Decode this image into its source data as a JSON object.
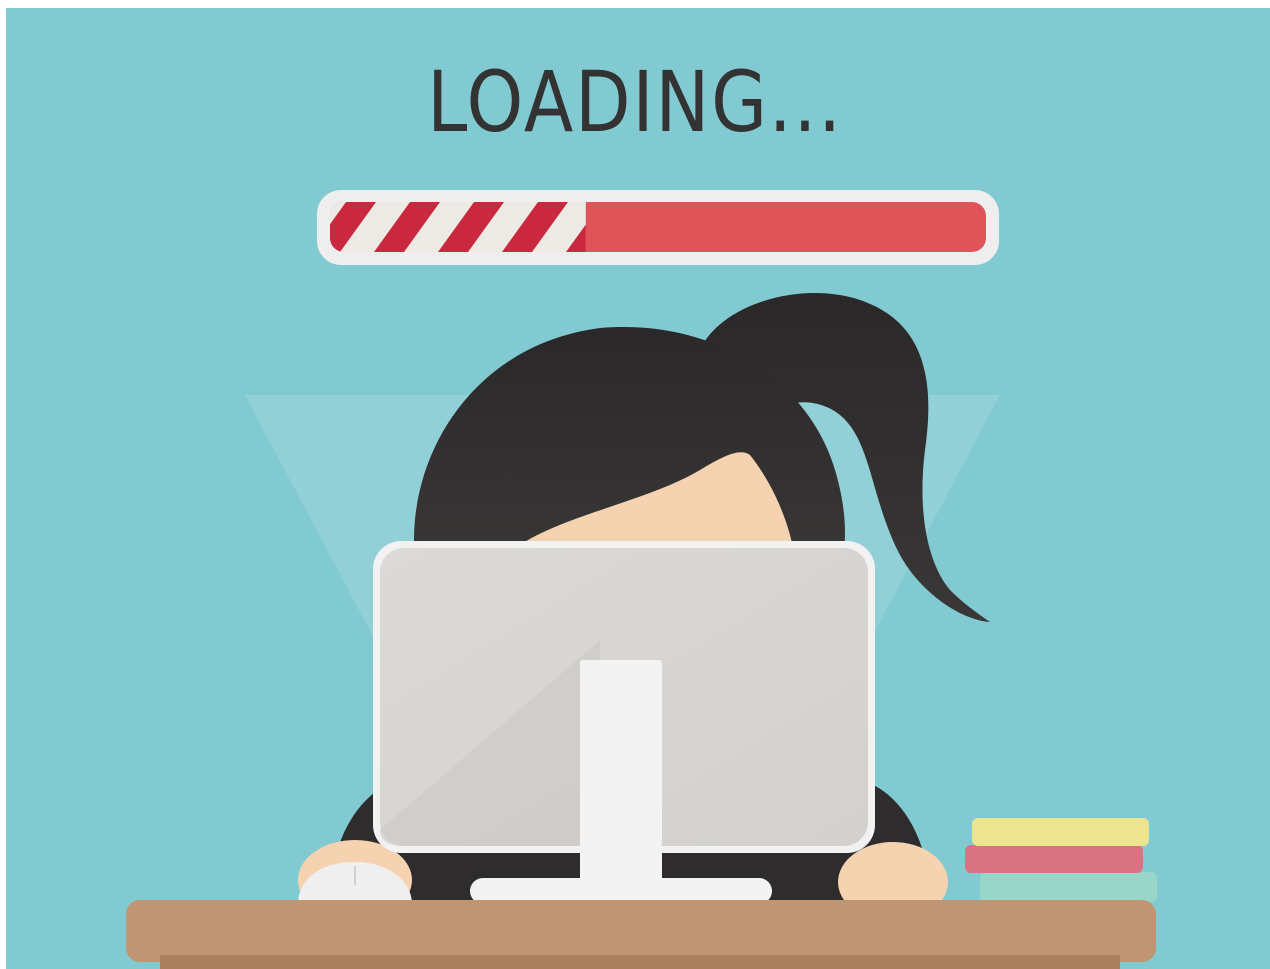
{
  "loading": {
    "title": "LOADING...",
    "progress": 0.39
  },
  "colors": {
    "background": "#82CAD1",
    "bar_fill": "#E05358",
    "stripe_red": "#C9283F",
    "stripe_light": "#EDE9E4",
    "hair": "#2E2C2D",
    "skin": "#F6D3B0",
    "monitor": "#D9D6D3",
    "desk": "#C09574",
    "book_yellow": "#EDE48F",
    "book_pink": "#D97282",
    "book_teal": "#98D7C8"
  }
}
